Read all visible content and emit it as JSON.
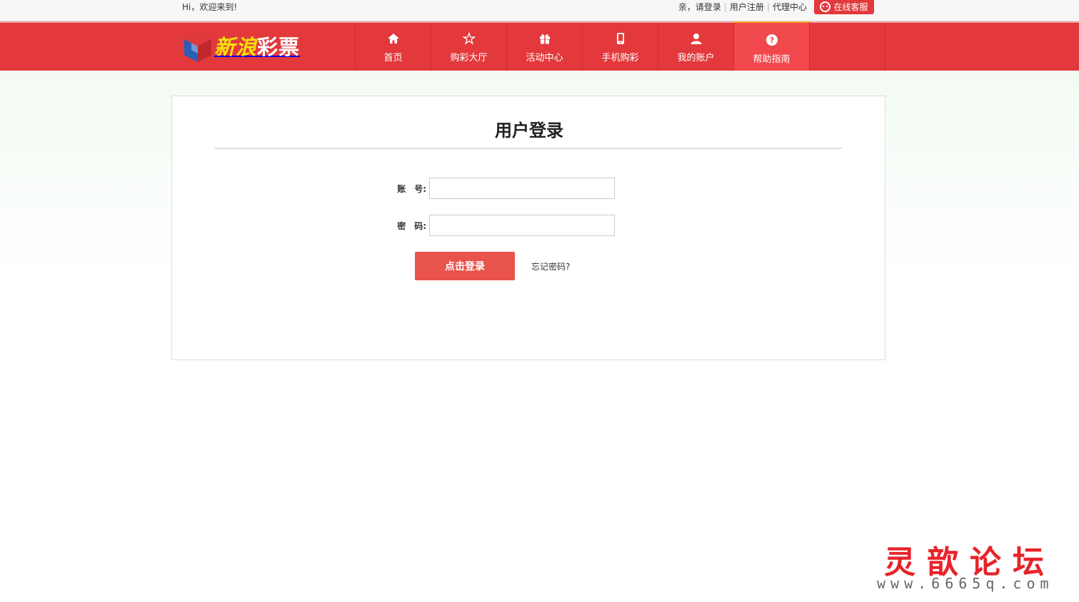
{
  "topbar": {
    "welcome": "Hi，欢迎来到!",
    "login_prompt": "亲，请登录",
    "register": "用户注册",
    "agent_center": "代理中心",
    "online_service": "在线客服"
  },
  "logo": {
    "text_part1": "新浪",
    "text_part2": "彩票"
  },
  "nav": {
    "items": [
      {
        "label": "首页",
        "icon": "home-icon"
      },
      {
        "label": "购彩大厅",
        "icon": "star-icon"
      },
      {
        "label": "活动中心",
        "icon": "gift-icon"
      },
      {
        "label": "手机购彩",
        "icon": "mobile-icon"
      },
      {
        "label": "我的账户",
        "icon": "user-icon"
      },
      {
        "label": "帮助指南",
        "icon": "help-icon"
      }
    ],
    "active_index": 5
  },
  "login": {
    "title": "用户登录",
    "account_label": "账　号:",
    "account_value": "",
    "password_label": "密　码:",
    "password_value": "",
    "submit_label": "点击登录",
    "forgot_label": "忘记密码?"
  },
  "watermark": {
    "title": "灵歆论坛",
    "url": "www.6665q.com"
  },
  "colors": {
    "brand_red": "#e3393c",
    "button_red": "#e8534b",
    "active_accent": "#f5a623"
  }
}
